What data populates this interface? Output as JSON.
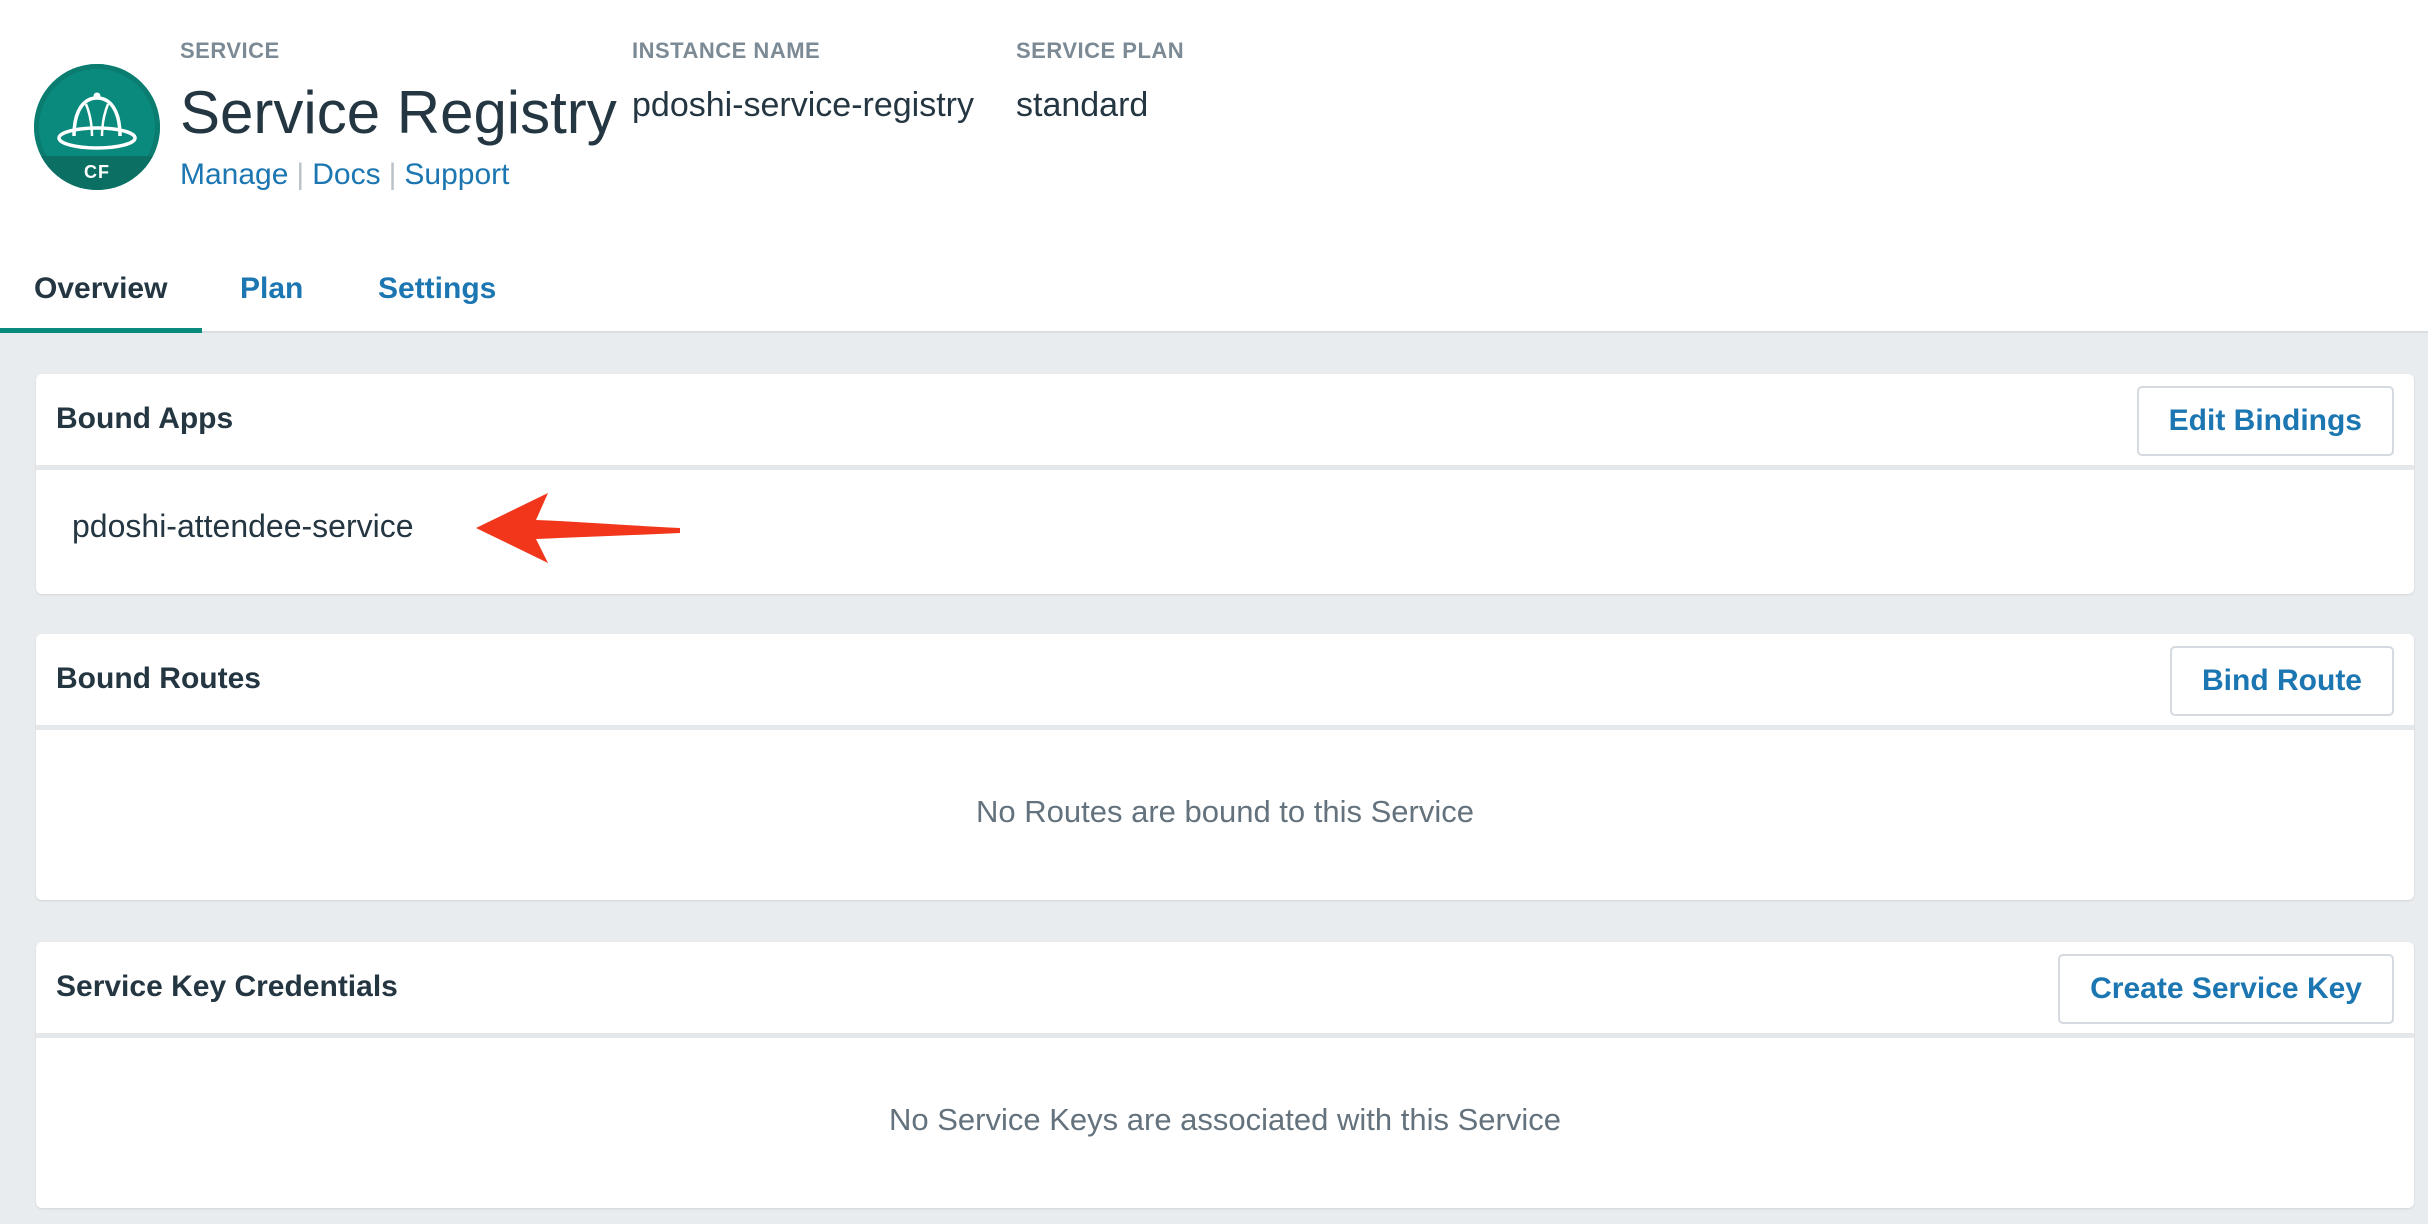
{
  "service": {
    "label": "SERVICE",
    "name": "Service Registry",
    "logo_text": "CF",
    "logo_icon": "hat-icon",
    "links": {
      "manage": "Manage",
      "docs": "Docs",
      "support": "Support"
    }
  },
  "instance": {
    "label": "INSTANCE NAME",
    "value": "pdoshi-service-registry"
  },
  "plan": {
    "label": "SERVICE PLAN",
    "value": "standard"
  },
  "tabs": [
    {
      "label": "Overview",
      "active": true
    },
    {
      "label": "Plan",
      "active": false
    },
    {
      "label": "Settings",
      "active": false
    }
  ],
  "bound_apps": {
    "title": "Bound Apps",
    "button": "Edit Bindings",
    "apps": [
      "pdoshi-attendee-service"
    ]
  },
  "bound_routes": {
    "title": "Bound Routes",
    "button": "Bind Route",
    "empty_message": "No Routes are bound to this Service"
  },
  "service_keys": {
    "title": "Service Key Credentials",
    "button": "Create Service Key",
    "empty_message": "No Service Keys are associated with this Service"
  },
  "colors": {
    "accent_teal": "#0a8a7d",
    "link_blue": "#1b76b1",
    "annotation_arrow": "#f2361b",
    "page_bg": "#e9ecee"
  }
}
